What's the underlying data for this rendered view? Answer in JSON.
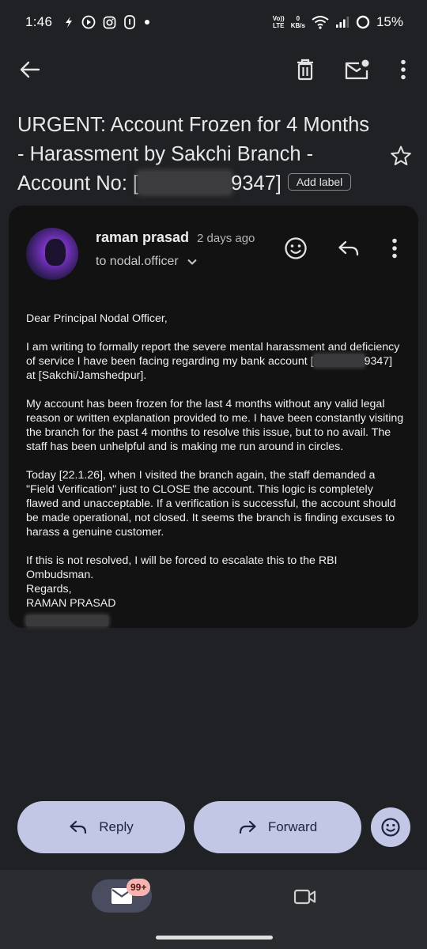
{
  "status_bar": {
    "time": "1:46",
    "network_top": "Vo))",
    "network_bottom": "LTE",
    "speed_top": "0",
    "speed_bottom": "KB/s",
    "battery": "15%"
  },
  "toolbar": {
    "icons": [
      "back-arrow-icon",
      "delete-icon",
      "mark-unread-icon",
      "more-vert-icon"
    ]
  },
  "subject": {
    "line1": "URGENT: Account Frozen for 4 Months",
    "line2": "- Harassment by Sakchi Branch -",
    "line3_prefix": "Account No: [",
    "line3_suffix": "9347]",
    "add_label": "Add label"
  },
  "message": {
    "sender": "raman prasad",
    "time": "2 days ago",
    "recipient": "to nodal.officer",
    "greeting": "Dear Principal Nodal Officer,",
    "p1_before": "I am writing to formally report the severe mental harassment and deficiency of service I have been facing regarding my bank account [",
    "p1_after": "9347] at [Sakchi/Jamshedpur].",
    "p2": "My account has been frozen for the last 4 months without any valid legal reason or written explanation provided to me. I have been constantly visiting the branch for the past 4 months to resolve this issue, but to no avail. The staff has been unhelpful and is making me run around in circles.",
    "p3": "Today [22.1.26], when I visited the branch again, the staff demanded a \"Field Verification\" just to CLOSE the account. This logic is completely flawed and unacceptable. If a verification is successful, the account should be made operational, not closed. It seems the branch is finding excuses to harass a genuine customer.",
    "p4": "If this is not resolved, I will be forced to escalate this to the RBI Ombudsman.",
    "regards": "Regards,",
    "signature": "RAMAN PRASAD"
  },
  "actions": {
    "reply": "Reply",
    "forward": "Forward"
  },
  "bottom_nav": {
    "mail_badge": "99+"
  },
  "colors": {
    "background": "#202124",
    "card": "#121212",
    "button": "#c2c7e6",
    "badge": "#f4b5b1"
  }
}
